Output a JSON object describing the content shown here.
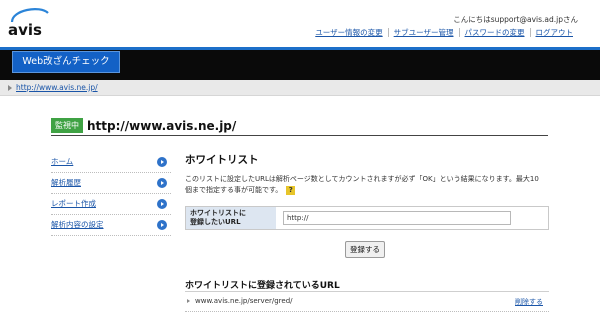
{
  "header": {
    "greeting": "こんにちはsupport@avis.ad.jpさん",
    "nav": [
      "ユーザー情報の変更",
      "サブユーザー管理",
      "パスワードの変更",
      "ログアウト"
    ],
    "logo_text": "avis",
    "service_name": "Web改ざんチェック"
  },
  "urlbar": {
    "link": "http://www.avis.ne.jp/"
  },
  "monitor": {
    "status": "監視中",
    "url": "http://www.avis.ne.jp/"
  },
  "sidebar": {
    "items": [
      {
        "label": "ホーム"
      },
      {
        "label": "解析履歴"
      },
      {
        "label": "レポート作成"
      },
      {
        "label": "解析内容の設定"
      }
    ]
  },
  "whitelist": {
    "title": "ホワイトリスト",
    "description": "このリストに設定したURLは解析ページ数としてカウントされますが必ず「OK」という結果になります。最大10個まで指定する事が可能です。",
    "help_label": "?",
    "form_label_line1": "ホワイトリストに",
    "form_label_line2": "登録したいURL",
    "input_value": "http://",
    "submit_label": "登録する",
    "registered_title": "ホワイトリストに登録されているURL",
    "registered": [
      {
        "url": "www.avis.ne.jp/server/gred/",
        "action": "削除する"
      }
    ]
  },
  "colors": {
    "accent_blue": "#1361c6",
    "header_blue_line": "#1c6fc9",
    "black_bar": "#0a0a0a",
    "monitor_green": "#3fa244",
    "link": "#1a55a8"
  },
  "icons": [
    "avis-logo",
    "arrow-right-icon",
    "help-icon",
    "triangle-bullet-icon"
  ]
}
